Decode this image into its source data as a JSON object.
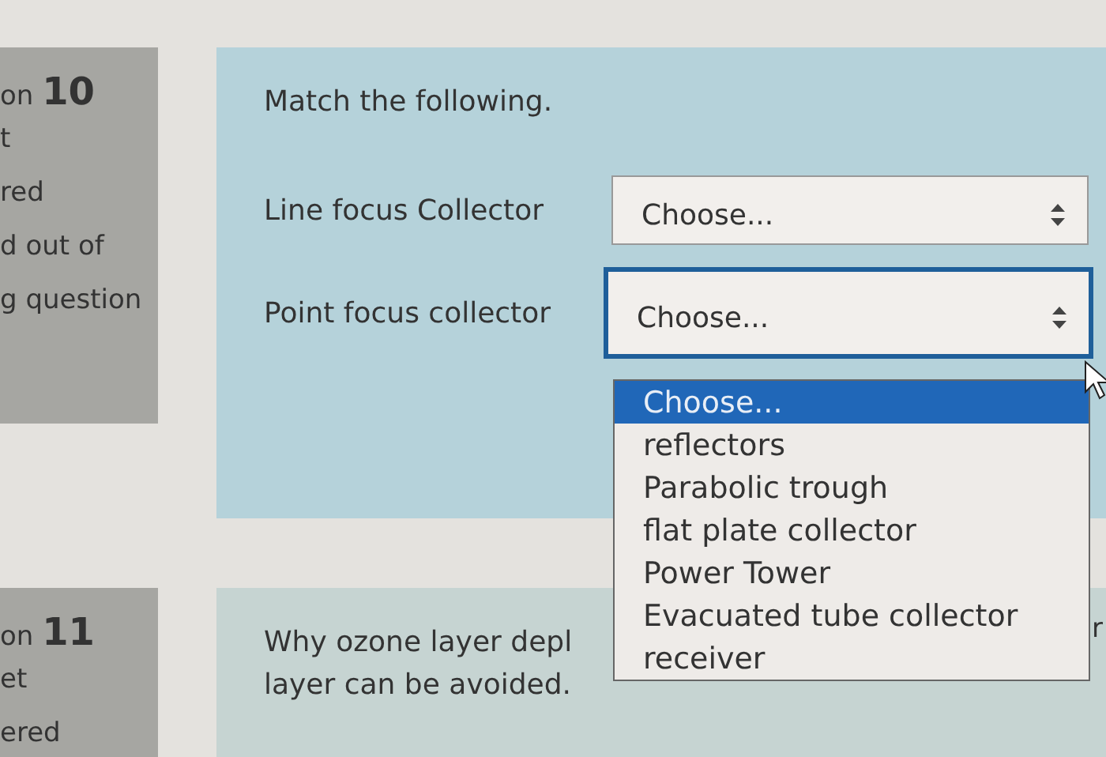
{
  "question_10": {
    "heading": "on **10**",
    "info": [
      "t",
      "red",
      "d out of",
      "g question"
    ],
    "prompt": "Match the following.",
    "rows": [
      {
        "label": "Line focus Collector",
        "value": "Choose...",
        "focused": false
      },
      {
        "label": "Point focus collector",
        "value": "Choose...",
        "focused": true
      }
    ],
    "dropdown": {
      "options": [
        {
          "label": "Choose...",
          "selected": true
        },
        {
          "label": "reflectors",
          "selected": false
        },
        {
          "label": "Parabolic trough",
          "selected": false
        },
        {
          "label": "flat plate collector",
          "selected": false
        },
        {
          "label": "Power Tower",
          "selected": false
        },
        {
          "label": "Evacuated tube collector",
          "selected": false
        },
        {
          "label": "receiver",
          "selected": false
        }
      ]
    }
  },
  "question_11": {
    "heading": "on **11**",
    "info": [
      "et",
      "ered"
    ],
    "text_lines": [
      "Why ozone layer depl",
      "layer can be avoided."
    ],
    "side_text": "r"
  }
}
